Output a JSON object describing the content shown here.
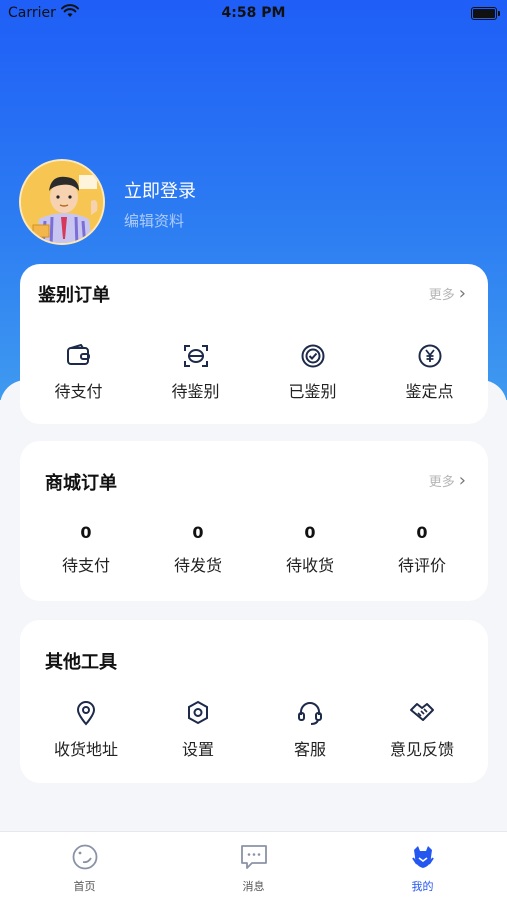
{
  "status_bar": {
    "carrier": "Carrier",
    "time": "4:58 PM"
  },
  "profile": {
    "login_text": "立即登录",
    "edit_text": "编辑资料"
  },
  "appraisal_orders": {
    "title": "鉴别订单",
    "more": "更多",
    "items": [
      {
        "label": "待支付",
        "icon": "wallet-icon"
      },
      {
        "label": "待鉴别",
        "icon": "scan-icon"
      },
      {
        "label": "已鉴别",
        "icon": "verified-badge-icon"
      },
      {
        "label": "鉴定点",
        "icon": "yen-coin-icon"
      }
    ]
  },
  "mall_orders": {
    "title": "商城订单",
    "more": "更多",
    "items": [
      {
        "count": "0",
        "label": "待支付"
      },
      {
        "count": "0",
        "label": "待发货"
      },
      {
        "count": "0",
        "label": "待收货"
      },
      {
        "count": "0",
        "label": "待评价"
      }
    ]
  },
  "other_tools": {
    "title": "其他工具",
    "items": [
      {
        "label": "收货地址",
        "icon": "location-pin-icon"
      },
      {
        "label": "设置",
        "icon": "hexagon-settings-icon"
      },
      {
        "label": "客服",
        "icon": "headset-icon"
      },
      {
        "label": "意见反馈",
        "icon": "handshake-icon"
      }
    ]
  },
  "tabbar": {
    "items": [
      {
        "label": "首页",
        "icon": "home-icon"
      },
      {
        "label": "消息",
        "icon": "message-icon"
      },
      {
        "label": "我的",
        "icon": "profile-mascot-icon"
      }
    ],
    "active_index": 2
  },
  "colors": {
    "primary": "#2457f0",
    "hero_top": "#1f5ef7",
    "hero_bottom": "#3f9af0",
    "background": "#f5f6f9"
  }
}
